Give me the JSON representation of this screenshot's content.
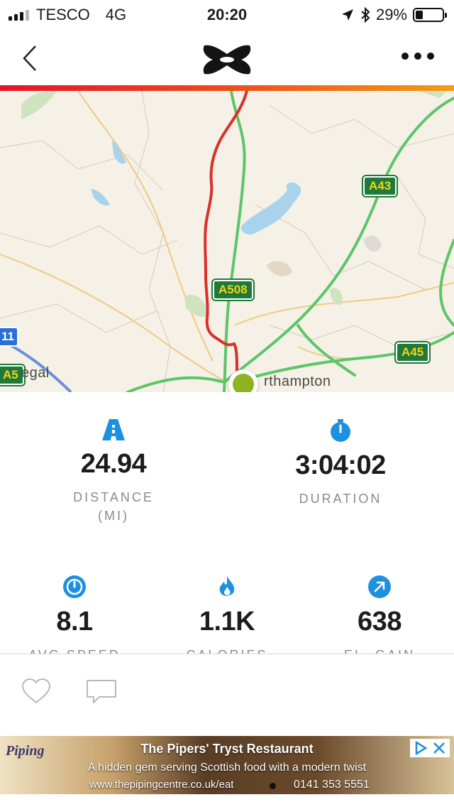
{
  "status_bar": {
    "carrier": "TESCO",
    "network": "4G",
    "time": "20:20",
    "battery": "29%",
    "battery_level": 0.29,
    "icons": [
      "signal-icon",
      "location-arrow-icon",
      "bluetooth-icon",
      "battery-icon"
    ]
  },
  "nav": {
    "back_icon": "chevron-left-icon",
    "logo": "under-armour-logo",
    "more_icon": "more-dots-icon"
  },
  "colors": {
    "accent_start": "#e4132b",
    "accent_end": "#f39c12",
    "route": "#d9302b",
    "road_badge_bg": "#1f7a3a",
    "road_badge_text": "#f4d21a",
    "icon_blue": "#1e90e0",
    "start_marker": "#8db320"
  },
  "map": {
    "road_badges": [
      "A43",
      "A508",
      "A45",
      "A5"
    ],
    "motorway_badge": "11",
    "place_labels": [
      "egal",
      "rthampton"
    ]
  },
  "stats": [
    {
      "icon": "road-icon",
      "value": "24.94",
      "label": "DISTANCE",
      "unit": "(MI)"
    },
    {
      "icon": "stopwatch-icon",
      "value": "3:04:02",
      "label": "DURATION"
    },
    {
      "icon": "speedometer-icon",
      "value": "8.1",
      "label": "AVG SPEED"
    },
    {
      "icon": "flame-icon",
      "value": "1.1K",
      "label": "CALORIES"
    },
    {
      "icon": "elevation-arrow-icon",
      "value": "638",
      "label": "EL. GAIN"
    }
  ],
  "actions": {
    "like_icon": "heart-icon",
    "comment_icon": "comment-icon"
  },
  "ad": {
    "logo_text": "Piping",
    "title": "The Pipers' Tryst Restaurant",
    "subtitle": "A hidden gem serving Scottish food with a modern twist",
    "url": "www.thepipingcentre.co.uk/eat",
    "phone": "0141 353 5551",
    "choices_icon": "ad-choices-icon",
    "close_icon": "close-icon"
  }
}
